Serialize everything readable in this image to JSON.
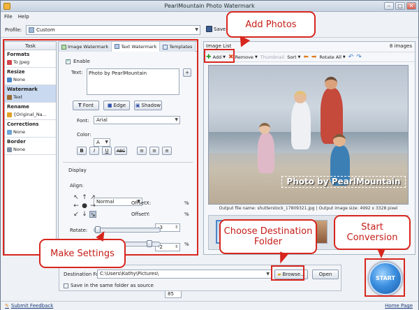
{
  "window": {
    "title": "PearlMountain Photo Watermark"
  },
  "menu": [
    "File",
    "Help"
  ],
  "profile": {
    "label": "Profile:",
    "value": "Custom",
    "save_label": "Save"
  },
  "tasks": {
    "header": "Task",
    "sections": [
      {
        "title": "Formats",
        "value": "To Jpeg"
      },
      {
        "title": "Resize",
        "value": "None"
      },
      {
        "title": "Watermark",
        "value": "Text"
      },
      {
        "title": "Rename",
        "value": "{Original_Na..."
      },
      {
        "title": "Corrections",
        "value": "None"
      },
      {
        "title": "Border",
        "value": "None"
      }
    ]
  },
  "watermark_panel": {
    "tabs": [
      "Image Watermark",
      "Text Watermark",
      "Templates"
    ],
    "enable_label": "Enable",
    "text_label": "Text:",
    "text_value": "Photo by PearlMountain",
    "add_label": "+",
    "style_buttons": [
      "Font",
      "Edge",
      "Shadow"
    ],
    "font_label": "Font:",
    "font_value": "Arial",
    "color_label": "Color:",
    "color_value": "A",
    "format_buttons": [
      "B",
      "I",
      "U",
      "ABC"
    ],
    "display_label": "Display",
    "align_label": "Align:",
    "align_value": "Normal",
    "offsetx_label": "OffsetX:",
    "offsetx_value": "-3",
    "offsety_label": "OffsetY:",
    "offsety_value": "-2",
    "percent": "%",
    "rotate_label": "Rotate:",
    "rotate_value": "0",
    "opacity_value": "85"
  },
  "image_list": {
    "title": "Image List",
    "count": "8 images",
    "toolbar": [
      "Add",
      "Remove",
      "Thumbnail",
      "Sort",
      "Rotate All"
    ],
    "watermark_overlay": "Photo by PearlMountain",
    "output_info": "Output file name: shutterstock_17809321.jpg | Output image size: 4992 x 3328 pixel"
  },
  "destination": {
    "label": "Destination Folder:",
    "path": "C:\\Users\\Kathy\\Pictures\\",
    "browse_label": "Browse...",
    "open_label": "Open",
    "same_folder_label": "Save in the same folder as source"
  },
  "start_label": "START",
  "status": {
    "feedback": "Submit Feedback",
    "homepage": "Home Page"
  },
  "annotations": {
    "add_photos": "Add Photos",
    "make_settings": "Make Settings",
    "choose_folder": "Choose Destination Folder",
    "start_conversion": "Start Conversion"
  },
  "colors": {
    "annotation_red": "#d7261e",
    "accent_blue": "#3c8fe0"
  }
}
